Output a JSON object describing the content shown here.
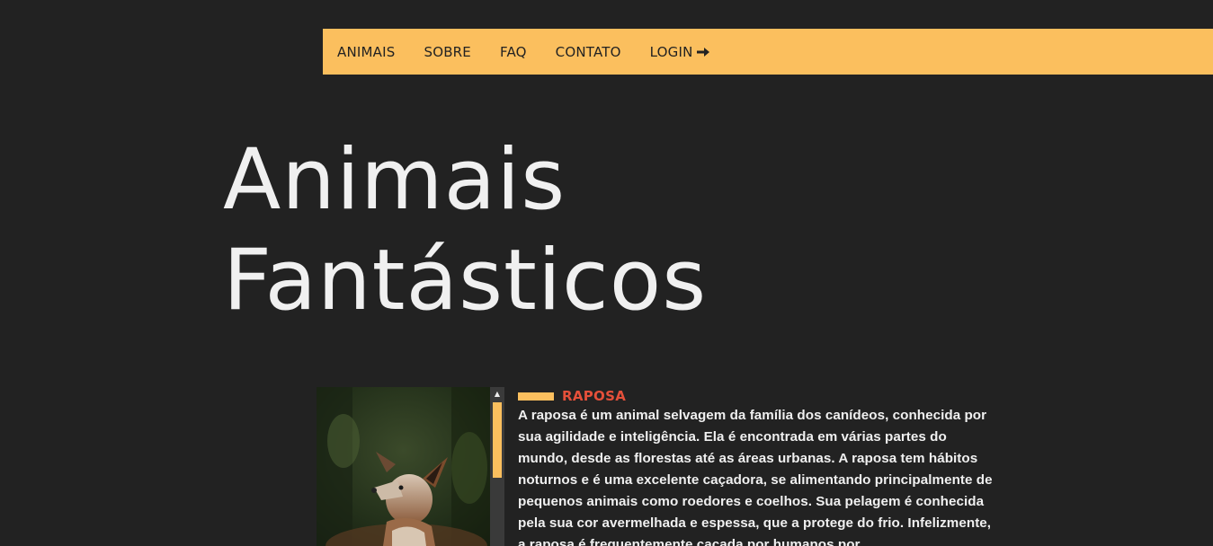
{
  "menu": {
    "items": [
      {
        "label": "ANIMAIS"
      },
      {
        "label": "SOBRE"
      },
      {
        "label": "FAQ"
      },
      {
        "label": "CONTATO"
      },
      {
        "label": "LOGIN"
      }
    ],
    "login_icon": "arrow-right-icon"
  },
  "hero": {
    "title_line1": "Animais",
    "title_line2": "Fantásticos"
  },
  "animal": {
    "image_alt": "Raposa",
    "name": "RAPOSA",
    "description": "A raposa é um animal selvagem da família dos canídeos, conhecida por sua agilidade e inteligência. Ela é encontrada em várias partes do mundo, desde as florestas até as áreas urbanas. A raposa tem hábitos noturnos e é uma excelente caçadora, se alimentando principalmente de pequenos animais como roedores e coelhos. Sua pelagem é conhecida pela sua cor avermelhada e espessa, que a protege do frio. Infelizmente, a raposa é frequentemente caçada por humanos por"
  },
  "colors": {
    "background": "#222222",
    "accent": "#fbbf5e",
    "heading_red": "#e5503a",
    "text": "#f0f0f0"
  }
}
